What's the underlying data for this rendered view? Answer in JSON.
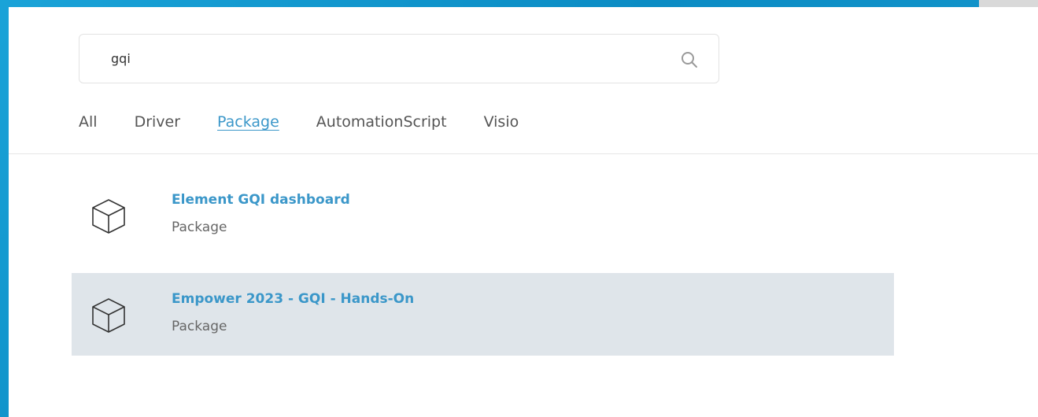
{
  "search": {
    "value": "gqi",
    "icon": "search-icon"
  },
  "tabs": [
    {
      "label": "All",
      "active": false
    },
    {
      "label": "Driver",
      "active": false
    },
    {
      "label": "Package",
      "active": true
    },
    {
      "label": "AutomationScript",
      "active": false
    },
    {
      "label": "Visio",
      "active": false
    }
  ],
  "results": [
    {
      "title": "Element GQI dashboard",
      "type": "Package",
      "icon": "package-box-icon",
      "highlighted": false
    },
    {
      "title": "Empower 2023 - GQI - Hands-On",
      "type": "Package",
      "icon": "package-box-icon",
      "highlighted": true
    }
  ],
  "colors": {
    "accent": "#3b97c9",
    "background": "#0b8cc4",
    "highlight_row": "#dfe5ea"
  }
}
